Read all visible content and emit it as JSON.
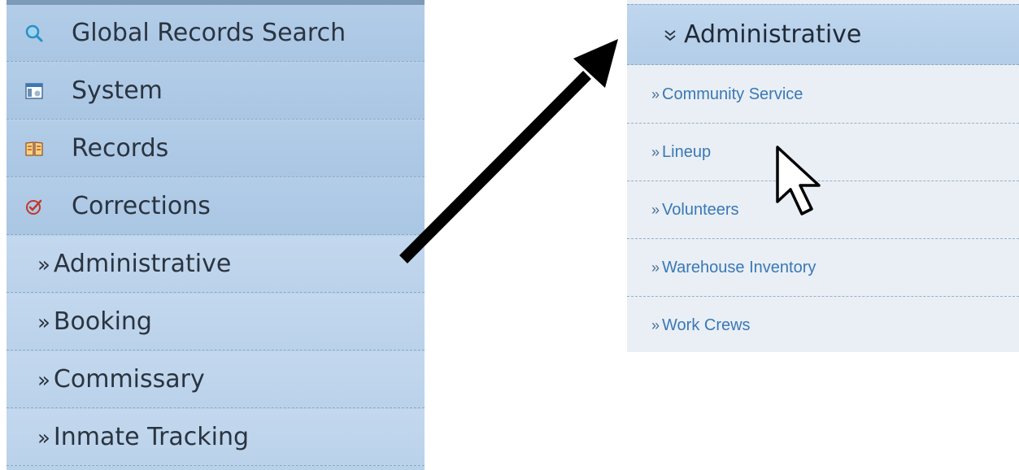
{
  "left_menu": {
    "items": [
      {
        "label": "Global Records Search",
        "icon": "search-icon"
      },
      {
        "label": "System",
        "icon": "system-window-icon"
      },
      {
        "label": "Records",
        "icon": "book-icon"
      },
      {
        "label": "Corrections",
        "icon": "checkmark-circle-icon"
      }
    ],
    "sub_items": [
      {
        "prefix": "»",
        "label": "Administrative"
      },
      {
        "prefix": "»",
        "label": "Booking"
      },
      {
        "prefix": "»",
        "label": "Commissary"
      },
      {
        "prefix": "»",
        "label": "Inmate Tracking"
      }
    ]
  },
  "right_panel": {
    "header": {
      "icon": "double-chevron-down-icon",
      "label": "Administrative"
    },
    "items": [
      {
        "prefix": "»",
        "label": "Community Service"
      },
      {
        "prefix": "»",
        "label": "Lineup"
      },
      {
        "prefix": "»",
        "label": "Volunteers"
      },
      {
        "prefix": "»",
        "label": "Warehouse Inventory"
      },
      {
        "prefix": "»",
        "label": "Work Crews"
      }
    ]
  },
  "colors": {
    "menu_bg": "#b7d1e9",
    "link_blue": "#3a78b5",
    "panel_bg": "#e9eff5",
    "arrow": "#000000"
  }
}
